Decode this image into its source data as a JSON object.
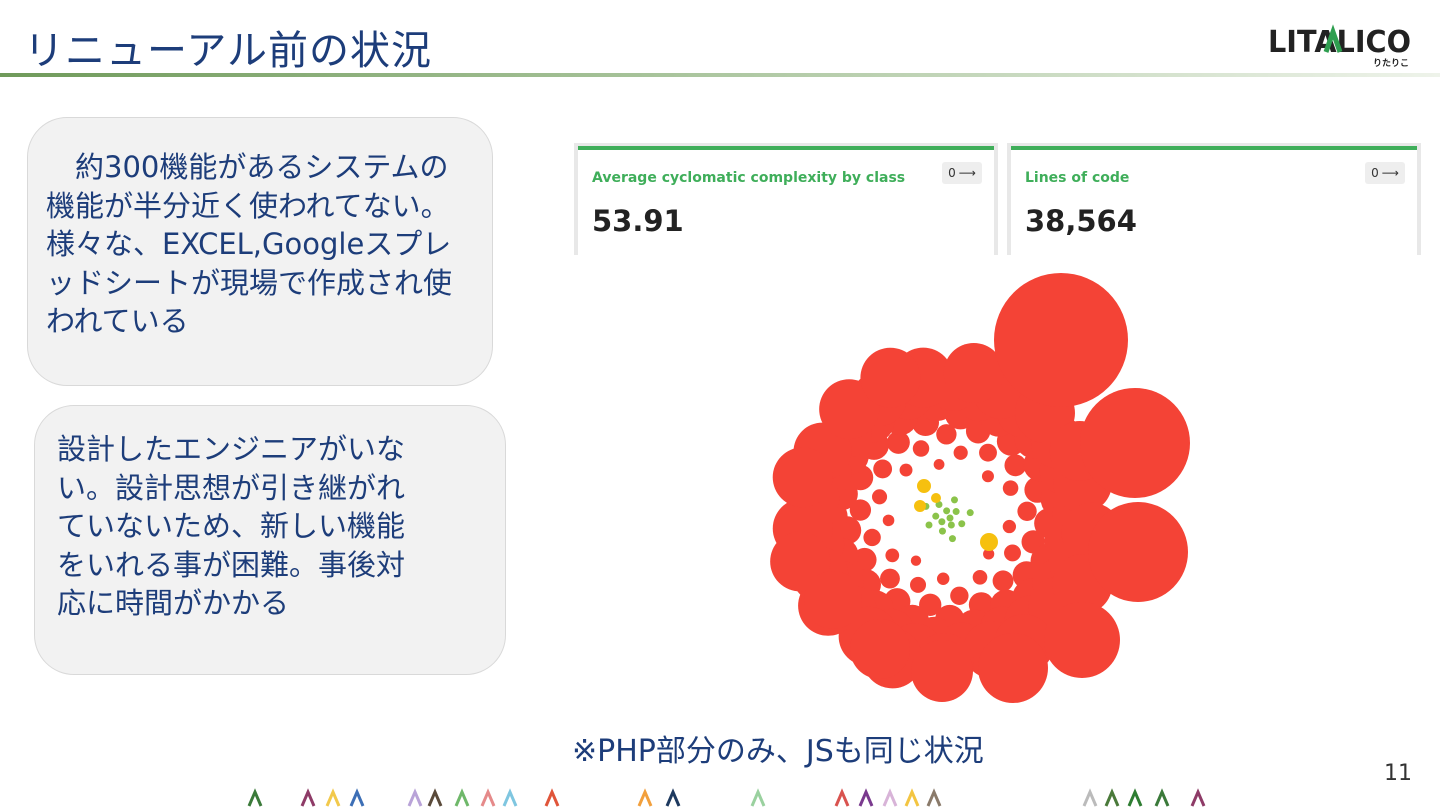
{
  "slide": {
    "title": "リニューアル前の状況",
    "page_number": "11",
    "note": "※PHP部分のみ、JSも同じ状況"
  },
  "logo": {
    "brand": "LITALICO",
    "sub": "りたりこ"
  },
  "bubbles": [
    {
      "text": "約300機能があるシステムの機能が半分近く使われてない。様々な、EXCEL,Googleスプレッドシートが現場で作成され使われている"
    },
    {
      "text": "設計したエンジニアがいない。設計思想が引き継がれていないため、新しい機能をいれる事が困難。事後対応に時間がかかる"
    }
  ],
  "metrics": [
    {
      "label": "Average cyclomatic complexity by class",
      "value": "53.91",
      "badge": "0"
    },
    {
      "label": "Lines of code",
      "value": "38,564",
      "badge": "0"
    }
  ],
  "colors": {
    "title": "#1d3d7a",
    "accent_green": "#3fae5a",
    "bubble_red": "#f44336",
    "bubble_yellow": "#f6c00f",
    "bubble_green": "#8bc34a"
  }
}
